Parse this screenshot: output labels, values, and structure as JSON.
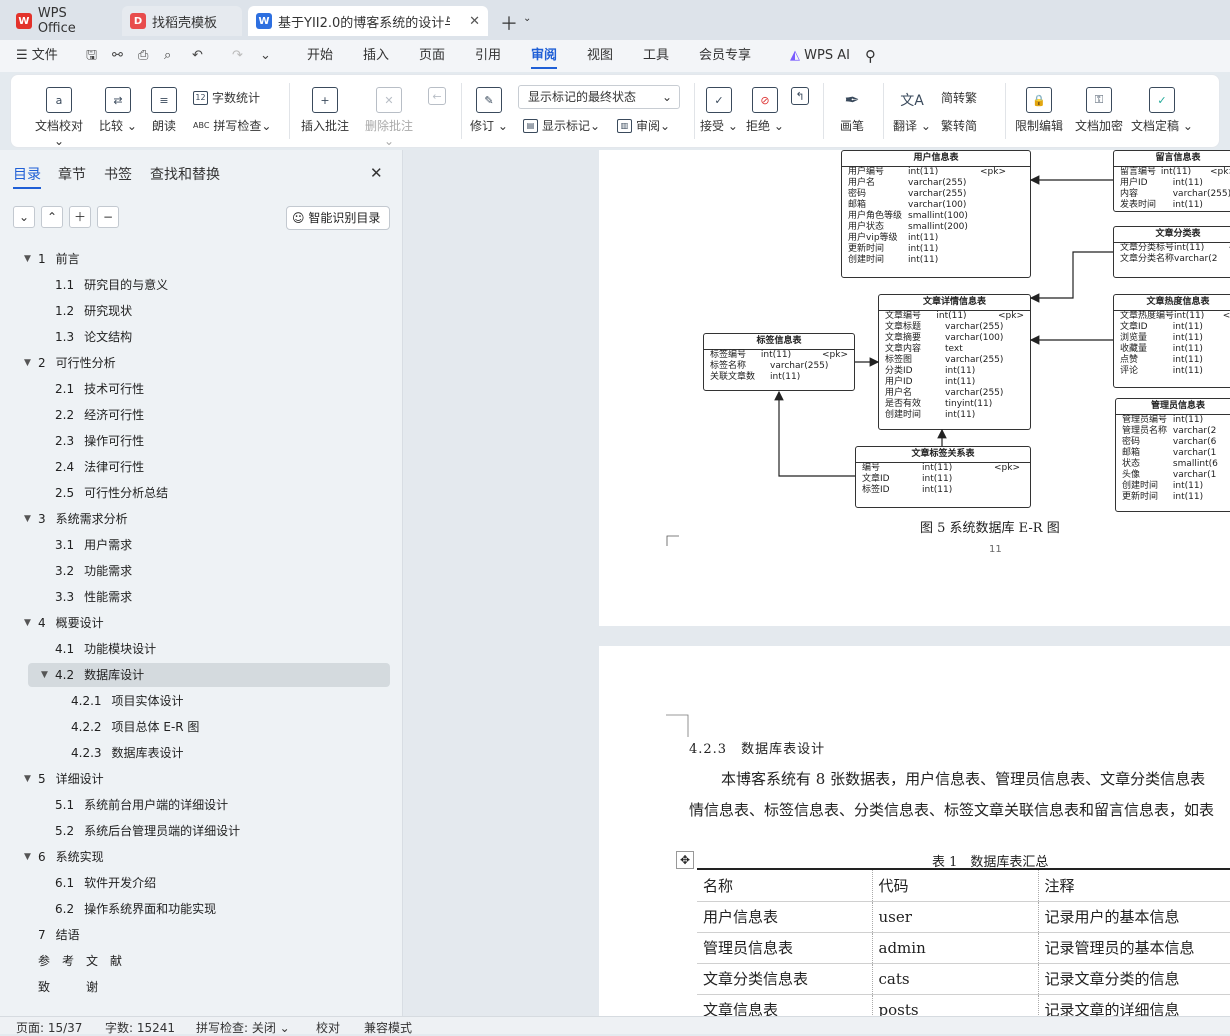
{
  "tabs": [
    {
      "label": "WPS Office"
    },
    {
      "label": "找稻壳模板"
    },
    {
      "label": "基于YII2.0的博客系统的设计与"
    }
  ],
  "menu": {
    "file": "文件",
    "items": [
      "开始",
      "插入",
      "页面",
      "引用",
      "审阅",
      "视图",
      "工具",
      "会员专享"
    ],
    "active": "审阅",
    "ai": "WPS AI"
  },
  "ribbon": {
    "doc_check": "文档校对",
    "compare": "比较",
    "read": "朗读",
    "word_count": "字数统计",
    "spell_check": "拼写检查",
    "insert_comment": "插入批注",
    "delete_comment": "删除批注",
    "revise": "修订",
    "markup_select": "显示标记的最终状态",
    "show_markup": "显示标记",
    "review": "审阅",
    "accept": "接受",
    "reject": "拒绝",
    "pen": "画笔",
    "translate": "翻译",
    "to_trad": "简转繁",
    "to_simp": "繁转简",
    "restrict": "限制编辑",
    "encrypt": "文档加密",
    "finalize": "文档定稿"
  },
  "sidebar": {
    "tabs": [
      "目录",
      "章节",
      "书签",
      "查找和替换"
    ],
    "smart_btn": "智能识别目录",
    "toc": [
      {
        "n": "1",
        "t": "前言",
        "lvl": 1,
        "arrow": true
      },
      {
        "n": "1.1",
        "t": "研究目的与意义",
        "lvl": 2
      },
      {
        "n": "1.2",
        "t": "研究现状",
        "lvl": 2
      },
      {
        "n": "1.3",
        "t": "论文结构",
        "lvl": 2
      },
      {
        "n": "2",
        "t": "可行性分析",
        "lvl": 1,
        "arrow": true
      },
      {
        "n": "2.1",
        "t": "技术可行性",
        "lvl": 2
      },
      {
        "n": "2.2",
        "t": "经济可行性",
        "lvl": 2
      },
      {
        "n": "2.3",
        "t": "操作可行性",
        "lvl": 2
      },
      {
        "n": "2.4",
        "t": "法律可行性",
        "lvl": 2
      },
      {
        "n": "2.5",
        "t": "可行性分析总结",
        "lvl": 2
      },
      {
        "n": "3",
        "t": "系统需求分析",
        "lvl": 1,
        "arrow": true
      },
      {
        "n": "3.1",
        "t": "用户需求",
        "lvl": 2
      },
      {
        "n": "3.2",
        "t": "功能需求",
        "lvl": 2
      },
      {
        "n": "3.3",
        "t": "性能需求",
        "lvl": 2
      },
      {
        "n": "4",
        "t": "概要设计",
        "lvl": 1,
        "arrow": true
      },
      {
        "n": "4.1",
        "t": "功能模块设计",
        "lvl": 2
      },
      {
        "n": "4.2",
        "t": "数据库设计",
        "lvl": 2,
        "arrow": true
      },
      {
        "n": "4.2.1",
        "t": "项目实体设计",
        "lvl": 3
      },
      {
        "n": "4.2.2",
        "t": "项目总体 E-R 图",
        "lvl": 3
      },
      {
        "n": "4.2.3",
        "t": "数据库表设计",
        "lvl": 3
      },
      {
        "n": "5",
        "t": "详细设计",
        "lvl": 1,
        "arrow": true
      },
      {
        "n": "5.1",
        "t": "系统前台用户端的详细设计",
        "lvl": 2
      },
      {
        "n": "5.2",
        "t": "系统后台管理员端的详细设计",
        "lvl": 2
      },
      {
        "n": "6",
        "t": "系统实现",
        "lvl": 1,
        "arrow": true
      },
      {
        "n": "6.1",
        "t": "软件开发介绍",
        "lvl": 2
      },
      {
        "n": "6.2",
        "t": "操作系统界面和功能实现",
        "lvl": 2
      },
      {
        "n": "7",
        "t": "结语",
        "lvl": 1
      },
      {
        "n": "",
        "t": "参　考　文　献",
        "lvl": 1
      },
      {
        "n": "",
        "t": "致　　　谢",
        "lvl": 1
      }
    ]
  },
  "doc": {
    "er_caption": "图 5 系统数据库 E-R 图",
    "page_no": "11",
    "er": {
      "user": {
        "title": "用户信息表",
        "rows": [
          [
            "用户编号",
            "int(11)",
            "<pk>"
          ],
          [
            "用户名",
            "varchar(255)",
            ""
          ],
          [
            "密码",
            "varchar(255)",
            ""
          ],
          [
            "邮箱",
            "varchar(100)",
            ""
          ],
          [
            "用户角色等级",
            "smallint(100)",
            ""
          ],
          [
            "用户状态",
            "smallint(200)",
            ""
          ],
          [
            "用户vip等级",
            "int(11)",
            ""
          ],
          [
            "更新时间",
            "int(11)",
            ""
          ],
          [
            "创建时间",
            "int(11)",
            ""
          ]
        ]
      },
      "msg": {
        "title": "留言信息表",
        "rows": [
          [
            "留言编号",
            "int(11)",
            "<pk>"
          ],
          [
            "用户ID",
            "int(11)",
            ""
          ],
          [
            "内容",
            "varchar(255)",
            ""
          ],
          [
            "发表时间",
            "int(11)",
            ""
          ]
        ]
      },
      "cat": {
        "title": "文章分类表",
        "rows": [
          [
            "文章分类标号",
            "int(11)",
            "<"
          ],
          [
            "文章分类名称",
            "varchar(2",
            ""
          ]
        ]
      },
      "post": {
        "title": "文章详情信息表",
        "rows": [
          [
            "文章编号",
            "int(11)",
            "<pk>"
          ],
          [
            "文章标题",
            "varchar(255)",
            ""
          ],
          [
            "文章摘要",
            "varchar(100)",
            ""
          ],
          [
            "文章内容",
            "text",
            ""
          ],
          [
            "标签图",
            "varchar(255)",
            ""
          ],
          [
            "分类ID",
            "int(11)",
            ""
          ],
          [
            "用户ID",
            "int(11)",
            ""
          ],
          [
            "用户名",
            "varchar(255)",
            ""
          ],
          [
            "是否有效",
            "tinyint(11)",
            ""
          ],
          [
            "创建时间",
            "int(11)",
            ""
          ]
        ]
      },
      "hot": {
        "title": "文章热度信息表",
        "rows": [
          [
            "文章热度编号",
            "int(11)",
            "<p"
          ],
          [
            "文章ID",
            "int(11)",
            ""
          ],
          [
            "浏览量",
            "int(11)",
            ""
          ],
          [
            "收藏量",
            "int(11)",
            ""
          ],
          [
            "点赞",
            "int(11)",
            ""
          ],
          [
            "评论",
            "int(11)",
            ""
          ]
        ]
      },
      "tag": {
        "title": "标签信息表",
        "rows": [
          [
            "标签编号",
            "int(11)",
            "<pk>"
          ],
          [
            "标签名称",
            "varchar(255)",
            ""
          ],
          [
            "关联文章数",
            "int(11)",
            ""
          ]
        ]
      },
      "admin": {
        "title": "管理员信息表",
        "rows": [
          [
            "管理员编号",
            "int(11)",
            ""
          ],
          [
            "管理员名称",
            "varchar(2",
            ""
          ],
          [
            "密码",
            "varchar(6",
            ""
          ],
          [
            "邮箱",
            "varchar(1",
            ""
          ],
          [
            "状态",
            "smallint(6",
            ""
          ],
          [
            "头像",
            "varchar(1",
            ""
          ],
          [
            "创建时间",
            "int(11)",
            ""
          ],
          [
            "更新时间",
            "int(11)",
            ""
          ]
        ]
      },
      "pt": {
        "title": "文章标签关系表",
        "rows": [
          [
            "编号",
            "int(11)",
            "<pk>"
          ],
          [
            "文章ID",
            "int(11)",
            ""
          ],
          [
            "标签ID",
            "int(11)",
            ""
          ]
        ]
      }
    },
    "heading": "4.2.3　数据库表设计",
    "para1": "本博客系统有 8 张数据表，用户信息表、管理员信息表、文章分类信息表",
    "para2": "情信息表、标签信息表、分类信息表、标签文章关联信息表和留言信息表，如表",
    "table_caption": "表 1　数据库表汇总",
    "table": [
      [
        "名称",
        "代码",
        "注释"
      ],
      [
        "用户信息表",
        "user",
        "记录用户的基本信息"
      ],
      [
        "管理员信息表",
        "admin",
        "记录管理员的基本信息"
      ],
      [
        "文章分类信息表",
        "cats",
        "记录文章分类的信息"
      ],
      [
        "文章信息表",
        "posts",
        "记录文章的详细信息"
      ]
    ]
  },
  "status": {
    "page": "页面: 15/37",
    "words": "字数: 15241",
    "spell": "拼写检查: 关闭",
    "proof": "校对",
    "compat": "兼容模式"
  }
}
